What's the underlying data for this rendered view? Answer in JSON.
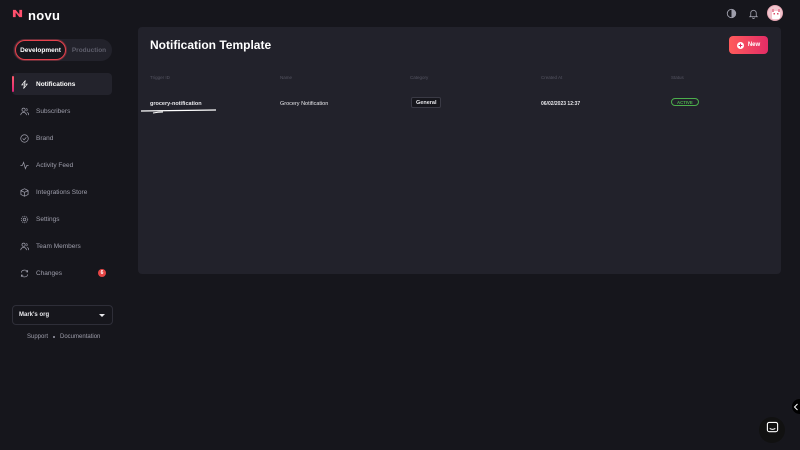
{
  "app": {
    "brand": "novu",
    "icons": {
      "logo": "novu-logo-icon",
      "theme": "theme-toggle-icon",
      "bell": "bell-icon",
      "avatar": "user-avatar"
    },
    "accent_color": "#e5424d"
  },
  "environment": {
    "options": [
      "Development",
      "Production"
    ],
    "selected": "Development"
  },
  "sidebar": {
    "items": [
      {
        "label": "Notifications",
        "icon": "bolt-icon",
        "active": true
      },
      {
        "label": "Subscribers",
        "icon": "users-icon"
      },
      {
        "label": "Brand",
        "icon": "check-circle-icon"
      },
      {
        "label": "Activity Feed",
        "icon": "activity-icon"
      },
      {
        "label": "Integrations Store",
        "icon": "box-icon"
      },
      {
        "label": "Settings",
        "icon": "gear-icon"
      },
      {
        "label": "Team Members",
        "icon": "team-icon"
      },
      {
        "label": "Changes",
        "icon": "sync-icon",
        "badge": "6"
      }
    ],
    "org": {
      "selected": "Mark's org"
    },
    "footer": {
      "support": "Support",
      "documentation": "Documentation"
    }
  },
  "main": {
    "title": "Notification Template",
    "new_button": "New",
    "table": {
      "columns": [
        "Trigger ID",
        "Name",
        "Category",
        "Created At",
        "Status"
      ],
      "rows": [
        {
          "trigger_id": "grocery-notification",
          "name": "Grocery Notification",
          "category": "General",
          "created_at": "06/02/2023 12:37",
          "status": "ACTIVE"
        }
      ]
    }
  }
}
